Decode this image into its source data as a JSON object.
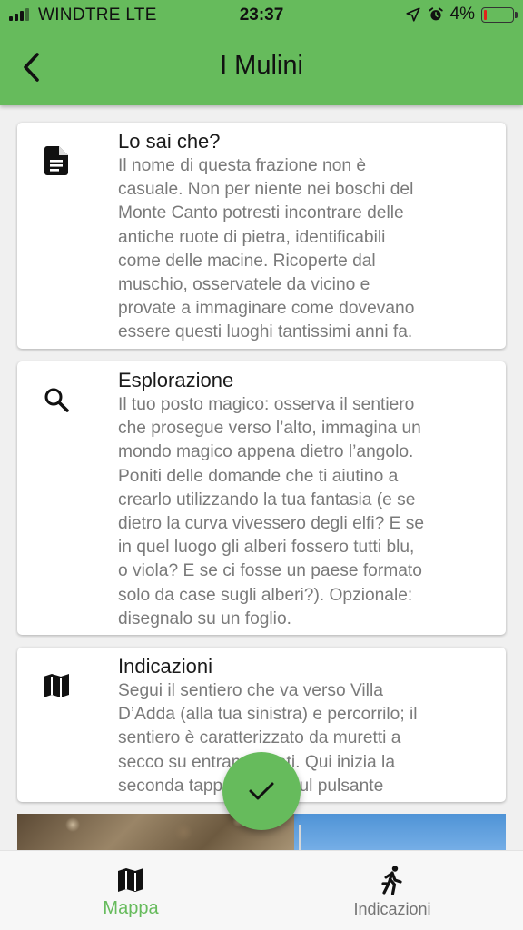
{
  "status_bar": {
    "carrier": "WINDTRE  LTE",
    "time": "23:37",
    "battery": "4%",
    "icons": [
      "signal-icon",
      "location-arrow-icon",
      "alarm-icon",
      "battery-icon"
    ]
  },
  "app_bar": {
    "title": "I Mulini",
    "back_icon": "chevron-left-icon",
    "color": "#66bb5c"
  },
  "cards": [
    {
      "icon": "document-icon",
      "title": "Lo sai che?",
      "body": "Il nome di questa frazione non è\ncasuale. Non per niente nei boschi del\nMonte Canto potresti incontrare delle\nantiche ruote di pietra, identificabili\ncome delle macine. Ricoperte dal\nmuschio, osservatele da vicino e\nprovate a immaginare come dovevano\nessere questi luoghi tantissimi anni fa."
    },
    {
      "icon": "search-icon",
      "title": "Esplorazione",
      "body": "Il tuo posto magico: osserva il sentiero\nche prosegue verso l’alto, immagina un\nmondo magico appena dietro l’angolo.\nPoniti delle domande che ti aiutino a\ncrearlo utilizzando la tua fantasia (e se\ndietro la curva vivessero degli elfi? E se\nin quel luogo gli alberi fossero tutti blu,\no viola? E se ci fosse un paese formato\nsolo da case sugli alberi?). Opzionale:\ndisegnalo su un foglio."
    },
    {
      "icon": "map-icon",
      "title": "Indicazioni",
      "body": "Segui il sentiero che va verso Villa\nD’Adda (alla tua sinistra) e percorrilo; il\nsentiero è caratterizzato da muretti a\nsecco su entrambi i lati. Qui inizia la\nseconda tappa: clicca sul pulsante"
    }
  ],
  "fab": {
    "icon": "check-icon"
  },
  "bottom_nav": {
    "items": [
      {
        "label": "Mappa",
        "icon": "map-icon",
        "active": true
      },
      {
        "label": "Indicazioni",
        "icon": "walking-person-icon",
        "active": false
      }
    ],
    "active_color": "#66bb5c"
  }
}
